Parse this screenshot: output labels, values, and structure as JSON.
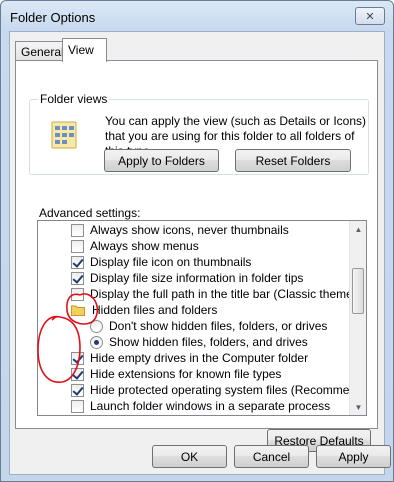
{
  "window": {
    "title": "Folder Options",
    "close_glyph": "✕"
  },
  "tabs": [
    {
      "label": "General"
    },
    {
      "label": "View"
    }
  ],
  "folder_views": {
    "title": "Folder views",
    "description": "You can apply the view (such as Details or Icons) that you are using for this folder to all folders of this type.",
    "apply_button": "Apply to Folders",
    "reset_button": "Reset Folders"
  },
  "advanced": {
    "label": "Advanced settings:",
    "items": [
      {
        "type": "checkbox",
        "checked": false,
        "label": "Always show icons, never thumbnails"
      },
      {
        "type": "checkbox",
        "checked": false,
        "label": "Always show menus"
      },
      {
        "type": "checkbox",
        "checked": true,
        "label": "Display file icon on thumbnails"
      },
      {
        "type": "checkbox",
        "checked": true,
        "label": "Display file size information in folder tips"
      },
      {
        "type": "checkbox",
        "checked": false,
        "label": "Display the full path in the title bar (Classic theme only)"
      },
      {
        "type": "folder",
        "label": "Hidden files and folders"
      },
      {
        "type": "radio",
        "checked": false,
        "label": "Don't show hidden files, folders, or drives"
      },
      {
        "type": "radio",
        "checked": true,
        "label": "Show hidden files, folders, and drives"
      },
      {
        "type": "checkbox",
        "checked": true,
        "label": "Hide empty drives in the Computer folder"
      },
      {
        "type": "checkbox",
        "checked": true,
        "label": "Hide extensions for known file types"
      },
      {
        "type": "checkbox",
        "checked": true,
        "label": "Hide protected operating system files (Recommended)"
      },
      {
        "type": "checkbox",
        "checked": false,
        "label": "Launch folder windows in a separate process"
      }
    ]
  },
  "buttons": {
    "restore": "Restore Defaults",
    "ok": "OK",
    "cancel": "Cancel",
    "apply": "Apply"
  },
  "icons": {
    "close": "close-icon",
    "folder_views": "folder-views-icon",
    "folder": "folder-icon",
    "scroll_up": "scroll-up-icon",
    "scroll_down": "scroll-down-icon"
  },
  "colors": {
    "annotation": "#e0101a",
    "check": "#1f3c78",
    "title_bar": "#c7d9ee"
  }
}
